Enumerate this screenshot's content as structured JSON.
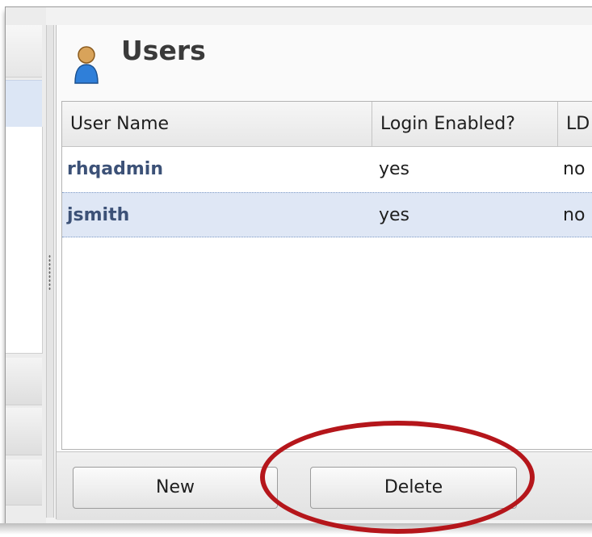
{
  "header": {
    "title": "Users",
    "icon": "user-icon"
  },
  "table": {
    "columns": [
      "User Name",
      "Login Enabled?",
      "LD"
    ],
    "rows": [
      {
        "name": "rhqadmin",
        "login_enabled": "yes",
        "ldap": "no"
      },
      {
        "name": "jsmith",
        "login_enabled": "yes",
        "ldap": "no"
      }
    ]
  },
  "footer": {
    "new_label": "New",
    "delete_label": "Delete"
  },
  "colors": {
    "highlight_circle": "#b5161b",
    "selected_row": "#dfe7f5",
    "name_text": "#3c5177"
  }
}
